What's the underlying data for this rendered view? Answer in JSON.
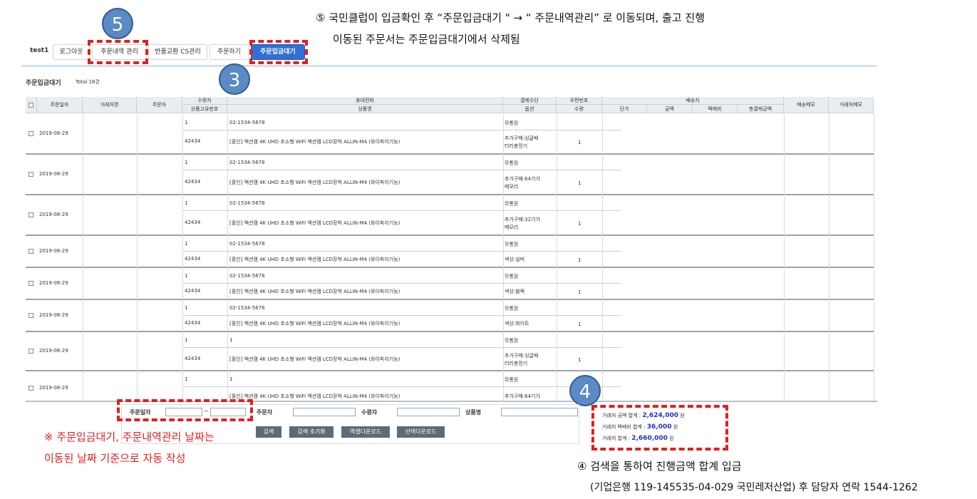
{
  "annotations": {
    "top_line1": "⑤ 국민클럽이 입금확인 후 “주문입금대기 \" → “ 주문내역관리” 로 이동되며, 출고 진행",
    "top_line2": "이동된 주문서는 주문입금대기에서 삭제됨",
    "note_line1": "※ 주문입금대기, 주문내역관리 날짜는",
    "note_line2": "이동된 날짜 기준으로 자동 작성",
    "bottom_line1": "④ 검색을 통하여 진행금액 합계 입금",
    "bottom_line2": "(기업은행 119-145535-04-029 국민레저산업) 후 담당자 연락 1544-1262",
    "badge5": "5",
    "badge3": "3",
    "badge4": "4"
  },
  "nav": {
    "user": "test1",
    "tabs": [
      "로그아웃",
      "주문내역 관리",
      "반품교환 CS관리",
      "주문하기",
      "주문입금대기"
    ]
  },
  "page": {
    "title": "주문입금대기",
    "total": "Total 16건"
  },
  "table": {
    "headers": {
      "date": "주문일자",
      "trader": "거래처명",
      "orderer": "주문자",
      "recipient": "수령자",
      "product_no": "상품고유번호",
      "phone": "휴대전화",
      "product_name": "상품명",
      "payment": "결제수단",
      "option": "옵션",
      "zip": "우편번호",
      "qty": "수량",
      "address": "배송지",
      "unit": "단가",
      "amount": "금액",
      "shipping": "택배비",
      "total_amount": "총결제금액",
      "ship_memo": "배송메모",
      "trader_memo": "거래처메모"
    },
    "orders": [
      {
        "date": "2019-08-29",
        "recipient": "1",
        "phone": "02-1534-5678",
        "payment": "무통장",
        "product_no": "42434",
        "product": "[홀인] 액션캠 4K UHD 초소형 WiFi 액션캠 LCD장착 ALLIN-M4 (와이파이기능)",
        "option_l1": "추가구매:싱글배",
        "option_l2": "터리충전기",
        "qty": "1"
      },
      {
        "date": "2019-08-29",
        "recipient": "1",
        "phone": "02-1534-5678",
        "payment": "무통장",
        "product_no": "42434",
        "product": "[홀인] 액션캠 4K UHD 초소형 WiFi 액션캠 LCD장착 ALLIN-M4 (와이파이기능)",
        "option_l1": "추가구매:64기가",
        "option_l2": "메모리",
        "qty": "1"
      },
      {
        "date": "2019-08-29",
        "recipient": "1",
        "phone": "02-1534-5678",
        "payment": "무통장",
        "product_no": "42434",
        "product": "[홀인] 액션캠 4K UHD 초소형 WiFi 액션캠 LCD장착 ALLIN-M4 (와이파이기능)",
        "option_l1": "추가구매:32기가",
        "option_l2": "메모리",
        "qty": "1"
      },
      {
        "date": "2019-08-29",
        "recipient": "1",
        "phone": "02-1534-5678",
        "payment": "무통장",
        "product_no": "42434",
        "product": "[홀인] 액션캠 4K UHD 초소형 WiFi 액션캠 LCD장착 ALLIN-M4 (와이파이기능)",
        "option_l1": "색상:실버",
        "option_l2": "",
        "qty": "1"
      },
      {
        "date": "2019-08-29",
        "recipient": "1",
        "phone": "02-1534-5678",
        "payment": "무통장",
        "product_no": "42434",
        "product": "[홀인] 액션캠 4K UHD 초소형 WiFi 액션캠 LCD장착 ALLIN-M4 (와이파이기능)",
        "option_l1": "색상:블랙",
        "option_l2": "",
        "qty": "1"
      },
      {
        "date": "2019-08-29",
        "recipient": "1",
        "phone": "02-1534-5678",
        "payment": "무통장",
        "product_no": "42434",
        "product": "[홀인] 액션캠 4K UHD 초소형 WiFi 액션캠 LCD장착 ALLIN-M4 (와이파이기능)",
        "option_l1": "색상:화이트",
        "option_l2": "",
        "qty": "1"
      },
      {
        "date": "2019-08-29",
        "recipient": "1",
        "phone": "1",
        "payment": "무통장",
        "product_no": "42434",
        "product": "[홀인] 액션캠 4K UHD 초소형 WiFi 액션캠 LCD장착 ALLIN-M4 (와이파이기능)",
        "option_l1": "추가구매:싱글배",
        "option_l2": "터리충전기",
        "qty": "1"
      },
      {
        "date": "2019-08-29",
        "recipient": "1",
        "phone": "1",
        "payment": "무통장",
        "product_no": "",
        "product": "[홀인] 액션캠 4K UHD 초소형 WiFi 액션캠 LCD장착 ALLIN-M4 (와이파이기능)",
        "option_l1": "추가구매:64기가",
        "option_l2": "",
        "qty": ""
      }
    ]
  },
  "search": {
    "date_label": "주문일자",
    "tilde": "~",
    "orderer_label": "주문자",
    "recipient_label": "수령자",
    "product_label": "상품명",
    "buttons": [
      "검색",
      "검색 초기화",
      "엑셀다운로드",
      "선택다운로드"
    ]
  },
  "summary": {
    "amount_label": "거래처 금액 합계 : ",
    "amount": "2,624,000",
    "shipping_label": "거래처 택배비 합계 : ",
    "shipping": "36,000",
    "total_label": "거래처 합계 : ",
    "total": "2,660,000",
    "unit": "원"
  }
}
